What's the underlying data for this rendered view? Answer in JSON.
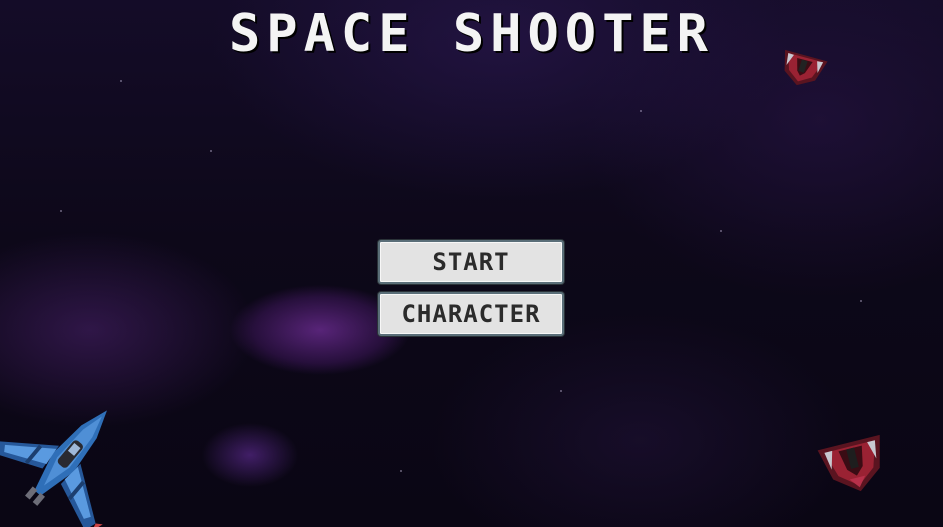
{
  "game": {
    "title": "SPACE SHOOTER"
  },
  "menu": {
    "start_label": "START",
    "character_label": "CHARACTER"
  },
  "sprites": {
    "player_ship": "blue-fighter-ship-icon",
    "enemy_ships": [
      "red-enemy-ship-icon",
      "red-enemy-ship-icon"
    ]
  },
  "colors": {
    "background": "#0b0716",
    "title": "#f4f4f4",
    "button_fill": "#e3e3e3",
    "button_border": "#5a6e78",
    "button_text": "#2b2b2b",
    "player_ship": "#2f6fb8",
    "enemy_ship": "#8e1e2e"
  }
}
